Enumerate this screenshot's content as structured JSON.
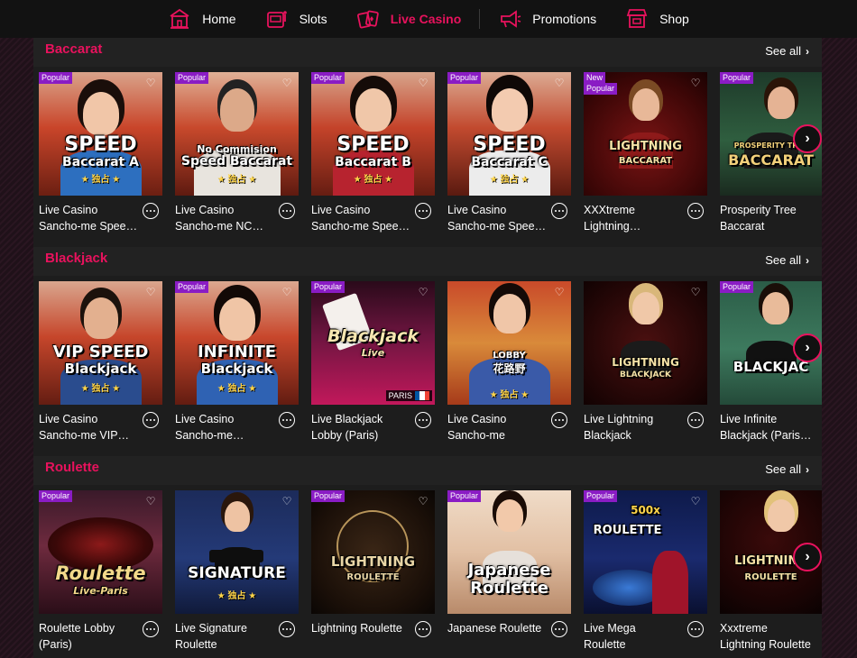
{
  "nav": {
    "items": [
      {
        "label": "Home",
        "icon": "home-icon"
      },
      {
        "label": "Slots",
        "icon": "slot-machine-icon"
      },
      {
        "label": "Live Casino",
        "icon": "playing-cards-icon",
        "active": true
      },
      {
        "label": "Promotions",
        "icon": "megaphone-icon"
      },
      {
        "label": "Shop",
        "icon": "shop-icon"
      }
    ]
  },
  "sections": [
    {
      "title": "Baccarat",
      "see_all": "See all",
      "cards": [
        {
          "badge": "Popular",
          "name1": "Live Casino",
          "name2": "Sancho-me Spee…",
          "art1": "SPEED",
          "art2": "Baccarat A",
          "sub": "★ 独占 ★"
        },
        {
          "badge": "Popular",
          "name1": "Live Casino",
          "name2": "Sancho-me NC…",
          "art1": "No Commision",
          "art2": "Speed Baccarat",
          "sub": "★ 独占 ★"
        },
        {
          "badge": "Popular",
          "name1": "Live Casino",
          "name2": "Sancho-me Spee…",
          "art1": "SPEED",
          "art2": "Baccarat B",
          "sub": "★ 独占 ★"
        },
        {
          "badge": "Popular",
          "name1": "Live Casino",
          "name2": "Sancho-me Spee…",
          "art1": "SPEED",
          "art2": "Baccarat C",
          "sub": "★ 独占 ★"
        },
        {
          "badge": "New",
          "badge2": "Popular",
          "name1": "XXXtreme",
          "name2": "Lightning…",
          "art1": "LIGHTNING",
          "art2": "BACCARAT",
          "sub": ""
        },
        {
          "badge": "Popular",
          "name1": "Prosperity Tree",
          "name2": "Baccarat",
          "art1": "PROSPERITY TREE",
          "art2": "BACCARAT",
          "sub": ""
        }
      ]
    },
    {
      "title": "Blackjack",
      "see_all": "See all",
      "cards": [
        {
          "badge": "",
          "name1": "Live Casino",
          "name2": "Sancho-me VIP…",
          "art1": "VIP SPEED",
          "art2": "Blackjack",
          "sub": "★ 独占 ★"
        },
        {
          "badge": "Popular",
          "name1": "Live Casino",
          "name2": "Sancho-me…",
          "art1": "INFINITE",
          "art2": "Blackjack",
          "sub": "★ 独占 ★"
        },
        {
          "badge": "Popular",
          "name1": "Live Blackjack",
          "name2": "Lobby (Paris)",
          "art1": "Blackjack",
          "art2": "Live",
          "sub": "",
          "flag": "PARIS"
        },
        {
          "badge": "",
          "name1": "Live Casino",
          "name2": "Sancho-me",
          "art1": "LOBBY",
          "art2": "花路野",
          "sub": "★ 独占 ★"
        },
        {
          "badge": "",
          "name1": "Live Lightning",
          "name2": "Blackjack",
          "art1": "LIGHTNING",
          "art2": "BLACKJACK",
          "sub": ""
        },
        {
          "badge": "Popular",
          "name1": "Live Infinite",
          "name2": "Blackjack (Paris…",
          "art1": "BLACKJAC",
          "art2": "",
          "sub": ""
        }
      ]
    },
    {
      "title": "Roulette",
      "see_all": "See all",
      "cards": [
        {
          "badge": "Popular",
          "name1": "Roulette Lobby",
          "name2": "(Paris)",
          "art1": "Roulette",
          "art2": "Live-Paris",
          "sub": ""
        },
        {
          "badge": "",
          "name1": "Live Signature",
          "name2": "Roulette",
          "art1": "SIGNATURE",
          "art2": "",
          "sub": "★ 独占 ★"
        },
        {
          "badge": "Popular",
          "name1": "Lightning Roulette",
          "name2": "",
          "art1": "LIGHTNING",
          "art2": "ROULETTE",
          "sub": ""
        },
        {
          "badge": "Popular",
          "name1": "Japanese Roulette",
          "name2": "",
          "art1": "Japanese",
          "art2": "Roulette",
          "sub": ""
        },
        {
          "badge": "Popular",
          "name1": "Live Mega",
          "name2": "Roulette",
          "art1": "500x",
          "art2": "ROULETTE",
          "sub": ""
        },
        {
          "badge": "",
          "name1": "Xxxtreme",
          "name2": "Lightning Roulette",
          "art1": "LIGHTNING",
          "art2": "ROULETTE",
          "sub": ""
        }
      ]
    }
  ]
}
